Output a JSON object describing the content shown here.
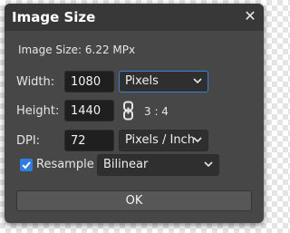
{
  "dialog": {
    "title": "Image Size",
    "close_icon": "close-icon",
    "info": "Image Size: 6.22 MPx"
  },
  "fields": {
    "width_label": "Width:",
    "width_value": "1080",
    "width_unit": "Pixels",
    "height_label": "Height:",
    "height_value": "1440",
    "link_icon": "chain-link-icon",
    "ratio": "3 : 4",
    "dpi_label": "DPI:",
    "dpi_value": "72",
    "dpi_unit": "Pixels / Inch"
  },
  "resample": {
    "label": "Resample",
    "checked": true,
    "method": "Bilinear"
  },
  "ok_label": "OK",
  "colors": {
    "dialog_bg": "#474747",
    "titlebar_bg": "#383838",
    "input_bg": "#1f1f1f",
    "accent": "#2f7de1",
    "focus_border": "#3b7fd9"
  }
}
